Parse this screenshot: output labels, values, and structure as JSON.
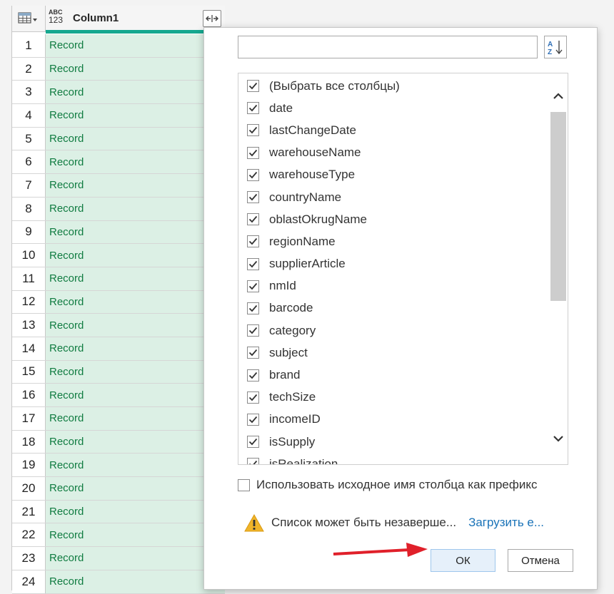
{
  "grid": {
    "type_badge_top": "ABC",
    "type_badge_bottom": "123",
    "column_title": "Column1",
    "rows": [
      {
        "num": "1",
        "value": "Record"
      },
      {
        "num": "2",
        "value": "Record"
      },
      {
        "num": "3",
        "value": "Record"
      },
      {
        "num": "4",
        "value": "Record"
      },
      {
        "num": "5",
        "value": "Record"
      },
      {
        "num": "6",
        "value": "Record"
      },
      {
        "num": "7",
        "value": "Record"
      },
      {
        "num": "8",
        "value": "Record"
      },
      {
        "num": "9",
        "value": "Record"
      },
      {
        "num": "10",
        "value": "Record"
      },
      {
        "num": "11",
        "value": "Record"
      },
      {
        "num": "12",
        "value": "Record"
      },
      {
        "num": "13",
        "value": "Record"
      },
      {
        "num": "14",
        "value": "Record"
      },
      {
        "num": "15",
        "value": "Record"
      },
      {
        "num": "16",
        "value": "Record"
      },
      {
        "num": "17",
        "value": "Record"
      },
      {
        "num": "18",
        "value": "Record"
      },
      {
        "num": "19",
        "value": "Record"
      },
      {
        "num": "20",
        "value": "Record"
      },
      {
        "num": "21",
        "value": "Record"
      },
      {
        "num": "22",
        "value": "Record"
      },
      {
        "num": "23",
        "value": "Record"
      },
      {
        "num": "24",
        "value": "Record"
      }
    ]
  },
  "popup": {
    "search_value": "",
    "sort_icon": "sort-az-icon",
    "columns": [
      {
        "label": "(Выбрать все столбцы)",
        "checked": true
      },
      {
        "label": "date",
        "checked": true
      },
      {
        "label": "lastChangeDate",
        "checked": true
      },
      {
        "label": "warehouseName",
        "checked": true
      },
      {
        "label": "warehouseType",
        "checked": true
      },
      {
        "label": "countryName",
        "checked": true
      },
      {
        "label": "oblastOkrugName",
        "checked": true
      },
      {
        "label": "regionName",
        "checked": true
      },
      {
        "label": "supplierArticle",
        "checked": true
      },
      {
        "label": "nmId",
        "checked": true
      },
      {
        "label": "barcode",
        "checked": true
      },
      {
        "label": "category",
        "checked": true
      },
      {
        "label": "subject",
        "checked": true
      },
      {
        "label": "brand",
        "checked": true
      },
      {
        "label": "techSize",
        "checked": true
      },
      {
        "label": "incomeID",
        "checked": true
      },
      {
        "label": "isSupply",
        "checked": true
      },
      {
        "label": "isRealization",
        "checked": true
      }
    ],
    "prefix_label": "Использовать исходное имя столбца как префикс",
    "prefix_checked": false,
    "warning_text": "Список может быть незаверше...",
    "load_more_link": "Загрузить е...",
    "ok_label": "ОК",
    "cancel_label": "Отмена"
  },
  "colors": {
    "accent": "#15a88f",
    "cell_bg": "#dcf0e5",
    "cell_text": "#107c41",
    "link": "#1a73b8",
    "arrow": "#e0202a",
    "warning": "#f0b429"
  }
}
